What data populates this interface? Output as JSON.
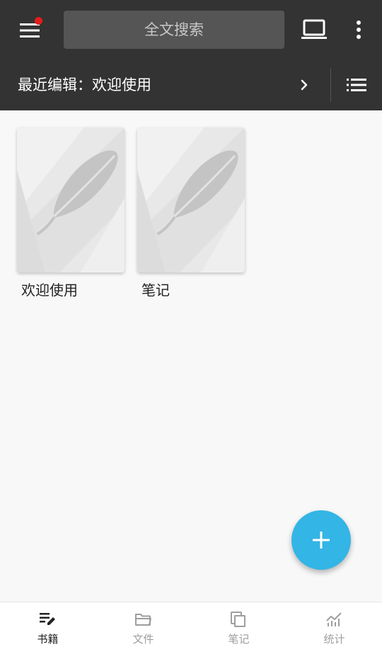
{
  "header": {
    "search": {
      "placeholder": "全文搜索"
    },
    "recent": {
      "prefix": "最近编辑：",
      "title": "欢迎使用"
    },
    "notification_dot_color": "#e51c1c"
  },
  "books": [
    {
      "title": "欢迎使用",
      "cover_icon": "feather-icon"
    },
    {
      "title": "笔记",
      "cover_icon": "feather-icon"
    }
  ],
  "bottom_nav": {
    "items": [
      {
        "label": "书籍",
        "icon": "books-edit-icon",
        "active": true
      },
      {
        "label": "文件",
        "icon": "folder-icon",
        "active": false
      },
      {
        "label": "笔记",
        "icon": "notes-icon",
        "active": false
      },
      {
        "label": "统计",
        "icon": "chart-icon",
        "active": false
      }
    ]
  },
  "colors": {
    "header_bg": "#333333",
    "search_bg": "#555555",
    "fab": "#33b5e5",
    "nav_active": "#222222",
    "nav_inactive": "#9e9e9e"
  }
}
